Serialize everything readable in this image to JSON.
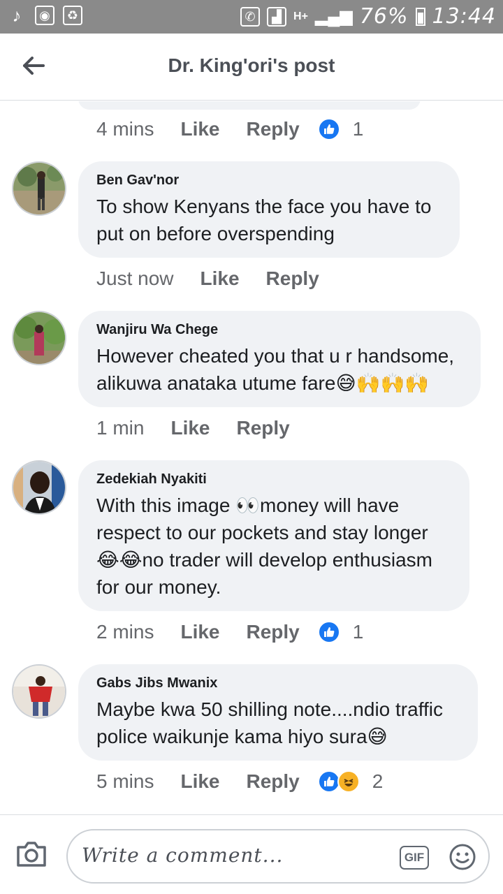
{
  "status_bar": {
    "network": "H+",
    "battery": "76%",
    "time": "13:44"
  },
  "header": {
    "title": "Dr. King'ori's post"
  },
  "previous_comment_meta": {
    "time": "4 mins",
    "like_label": "Like",
    "reply_label": "Reply",
    "reactions_count": "1"
  },
  "comments": [
    {
      "author": "Ben Gav'nor",
      "text": "To show Kenyans the face you have to put on before overspending",
      "time": "Just now",
      "like_label": "Like",
      "reply_label": "Reply"
    },
    {
      "author": "Wanjiru Wa Chege",
      "text_line1": "However cheated you that u r handsome,",
      "text_line2": "alikuwa anataka utume fare",
      "emojis": "😅🙌🙌🙌",
      "time": "1 min",
      "like_label": "Like",
      "reply_label": "Reply"
    },
    {
      "author": "Zedekiah Nyakiti",
      "text_part1": "With this image ",
      "emoji_eyes": "👀",
      "text_part2": "money will have respect to our pockets and stay longer ",
      "emoji_joy": "😂😂",
      "text_part3": "no trader will develop enthusiasm for our money.",
      "time": "2 mins",
      "like_label": "Like",
      "reply_label": "Reply",
      "reactions_count": "1"
    },
    {
      "author": "Gabs Jibs Mwanix",
      "text": "Maybe kwa 50 shilling note....ndio traffic police waikunje kama hiyo sura",
      "emoji": "😅",
      "time": "5 mins",
      "like_label": "Like",
      "reply_label": "Reply",
      "reactions_count": "2"
    }
  ],
  "composer": {
    "placeholder": "Write a comment...",
    "gif_label": "GIF"
  },
  "colors": {
    "accent": "#1877f2",
    "bubble": "#f0f2f5",
    "status_bar": "#8a8a8a",
    "meta_text": "#65676b"
  }
}
